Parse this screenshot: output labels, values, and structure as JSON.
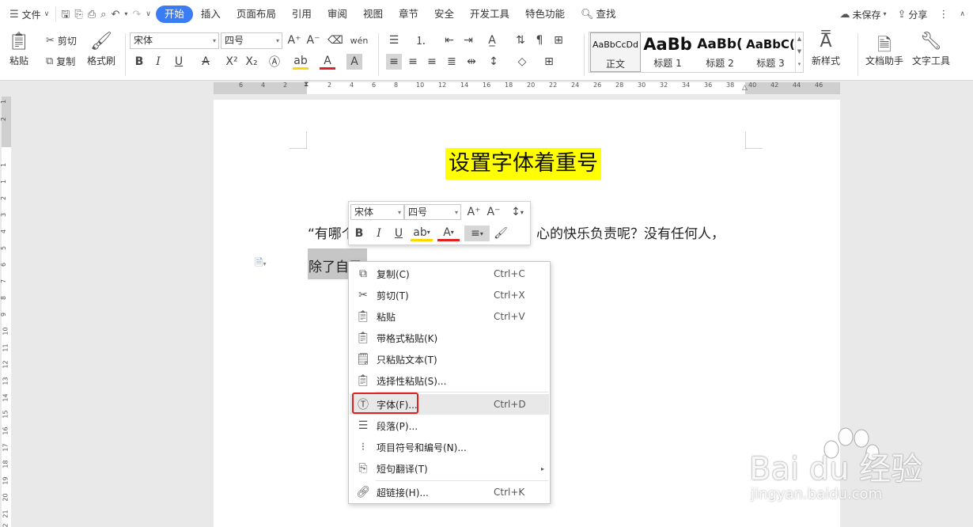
{
  "menubar": {
    "file_label": "文件",
    "tabs": [
      "开始",
      "插入",
      "页面布局",
      "引用",
      "审阅",
      "视图",
      "章节",
      "安全",
      "开发工具",
      "特色功能"
    ],
    "active_tab": "开始",
    "search_label": "查找",
    "save_status": "未保存",
    "share_label": "分享"
  },
  "ribbon": {
    "paste_label": "粘贴",
    "cut_label": "剪切",
    "copy_label": "复制",
    "format_painter_label": "格式刷",
    "font_name": "宋体",
    "font_size": "四号",
    "styles": [
      {
        "preview": "AaBbCcDd",
        "label": "正文"
      },
      {
        "preview": "AaBb",
        "label": "标题 1"
      },
      {
        "preview": "AaBb(",
        "label": "标题 2"
      },
      {
        "preview": "AaBbC(",
        "label": "标题 3"
      }
    ],
    "new_style_label": "新样式",
    "doc_assistant_label": "文档助手",
    "text_tools_label": "文字工具"
  },
  "ruler": {
    "h_numbers": [
      "6",
      "4",
      "2",
      "2",
      "4",
      "6",
      "8",
      "10",
      "12",
      "14",
      "16",
      "18",
      "20",
      "22",
      "24",
      "26",
      "28",
      "30",
      "32",
      "34",
      "36",
      "38",
      "40",
      "42",
      "44",
      "46"
    ],
    "v_numbers": [
      "1",
      "2",
      "1",
      "1",
      "2",
      "3",
      "4",
      "5",
      "6",
      "7",
      "8",
      "9",
      "10",
      "11",
      "12",
      "13",
      "14",
      "15",
      "16",
      "17",
      "18",
      "19",
      "20",
      "21",
      "22"
    ]
  },
  "document": {
    "title": "设置字体着重号",
    "line1_left": "“有哪个",
    "line1_right": "心的快乐负责呢？没有任何人，",
    "line2": "除了自己。”"
  },
  "mini_toolbar": {
    "font_name": "宋体",
    "font_size": "四号"
  },
  "context_menu": {
    "items": [
      {
        "label": "复制(C)",
        "shortcut": "Ctrl+C"
      },
      {
        "label": "剪切(T)",
        "shortcut": "Ctrl+X"
      },
      {
        "label": "粘贴",
        "shortcut": "Ctrl+V"
      },
      {
        "label": "带格式粘贴(K)",
        "shortcut": ""
      },
      {
        "label": "只粘贴文本(T)",
        "shortcut": ""
      },
      {
        "label": "选择性粘贴(S)...",
        "shortcut": ""
      },
      {
        "label": "字体(F)...",
        "shortcut": "Ctrl+D"
      },
      {
        "label": "段落(P)...",
        "shortcut": ""
      },
      {
        "label": "项目符号和编号(N)...",
        "shortcut": ""
      },
      {
        "label": "短句翻译(T)",
        "shortcut": ""
      },
      {
        "label": "超链接(H)...",
        "shortcut": "Ctrl+K"
      }
    ]
  },
  "watermark": {
    "text": "Bai du 经验",
    "sub": "jingyan.baidu.com"
  },
  "colors": {
    "accent": "#3a7cf4",
    "title_highlight": "#ffff00",
    "selection": "#c6c6c6",
    "callout_border": "#e02020"
  }
}
